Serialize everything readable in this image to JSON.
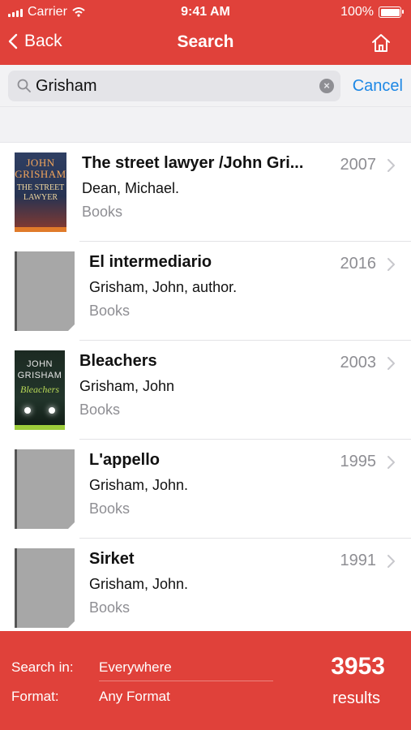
{
  "status": {
    "carrier": "Carrier",
    "time": "9:41 AM",
    "battery": "100%"
  },
  "nav": {
    "back": "Back",
    "title": "Search"
  },
  "search": {
    "query": "Grisham",
    "cancel": "Cancel"
  },
  "results": [
    {
      "title": "The street lawyer /John Gri...",
      "author": "Dean, Michael.",
      "type": "Books",
      "year": "2007",
      "cover": "the-street-lawyer",
      "cover_text": {
        "line1": "JOHN GRISHAM",
        "line2": "THE STREET LAWYER"
      }
    },
    {
      "title": "El intermediario",
      "author": "Grisham, John, author.",
      "type": "Books",
      "year": "2016",
      "cover": "placeholder"
    },
    {
      "title": "Bleachers",
      "author": "Grisham, John",
      "type": "Books",
      "year": "2003",
      "cover": "bleachers",
      "cover_text": {
        "line1": "JOHN GRISHAM",
        "line2": "Bleachers"
      }
    },
    {
      "title": "L'appello",
      "author": "Grisham, John.",
      "type": "Books",
      "year": "1995",
      "cover": "placeholder"
    },
    {
      "title": "Sirket",
      "author": "Grisham, John.",
      "type": "Books",
      "year": "1991",
      "cover": "placeholder"
    }
  ],
  "footer": {
    "search_in_label": "Search in:",
    "search_in_value": "Everywhere",
    "format_label": "Format:",
    "format_value": "Any Format",
    "count": "3953",
    "count_label": "results"
  },
  "colors": {
    "brand": "#e0413a",
    "link": "#1e88e5",
    "muted": "#8e8e93"
  }
}
